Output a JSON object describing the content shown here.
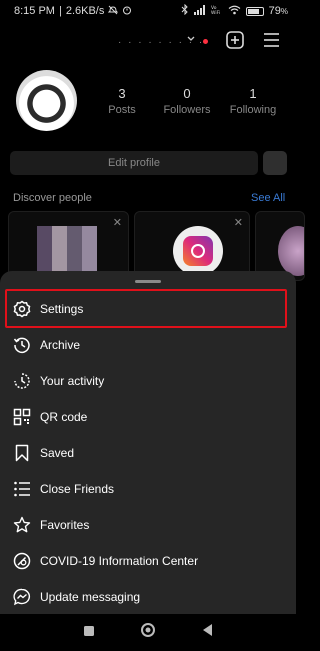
{
  "status_bar": {
    "time": "8:15 PM",
    "speed": "2.6KB/s",
    "battery": "79",
    "battery_unit": "%",
    "battery_level": 0.79
  },
  "profile": {
    "username_masked": "· · · · · · · · ·",
    "stats": [
      {
        "value": "3",
        "label": "Posts"
      },
      {
        "value": "0",
        "label": "Followers"
      },
      {
        "value": "1",
        "label": "Following"
      }
    ],
    "edit_label": "Edit profile"
  },
  "discover": {
    "title": "Discover people",
    "see_all": "See All"
  },
  "menu": {
    "items": [
      {
        "label": "Settings",
        "icon": "settings-icon"
      },
      {
        "label": "Archive",
        "icon": "archive-icon"
      },
      {
        "label": "Your activity",
        "icon": "activity-icon"
      },
      {
        "label": "QR code",
        "icon": "qr-code-icon"
      },
      {
        "label": "Saved",
        "icon": "bookmark-icon"
      },
      {
        "label": "Close Friends",
        "icon": "close-friends-icon"
      },
      {
        "label": "Favorites",
        "icon": "star-icon"
      },
      {
        "label": "COVID-19 Information Center",
        "icon": "covid-info-icon"
      },
      {
        "label": "Update messaging",
        "icon": "messenger-icon"
      }
    ]
  },
  "colors": {
    "highlight": "#e0101a",
    "link": "#3a7bd5",
    "sheet": "#262626"
  }
}
